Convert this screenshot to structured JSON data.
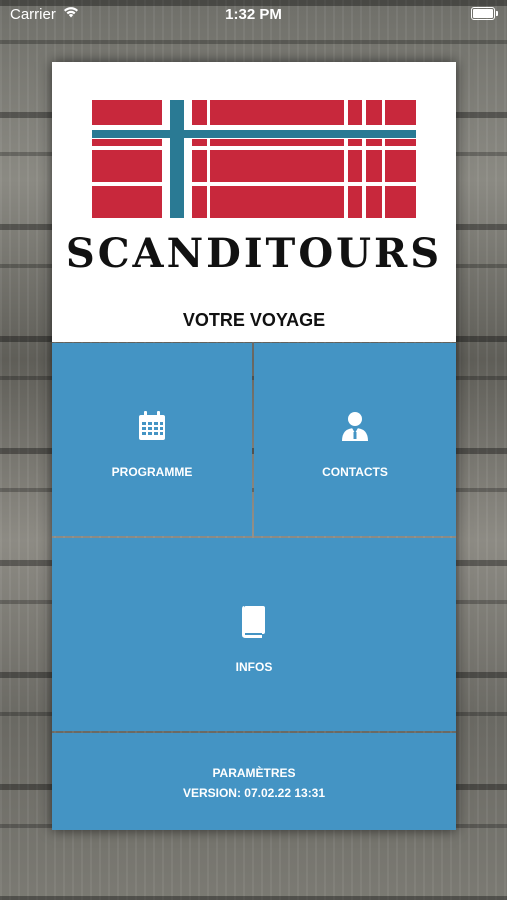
{
  "status_bar": {
    "carrier": "Carrier",
    "time": "1:32 PM"
  },
  "brand": {
    "name": "SCANDITOURS"
  },
  "header": {
    "title": "VOTRE VOYAGE"
  },
  "tiles": {
    "programme": {
      "label": "PROGRAMME",
      "icon": "calendar-icon"
    },
    "contacts": {
      "label": "CONTACTS",
      "icon": "contact-person-icon"
    },
    "infos": {
      "label": "INFOS",
      "icon": "book-icon"
    }
  },
  "footer": {
    "settings_label": "PARAMÈTRES",
    "version": "VERSION: 07.02.22 13:31"
  },
  "colors": {
    "tile_blue": "#4494c4",
    "flag_red": "#c8283c",
    "flag_blue": "#2a7a94"
  }
}
